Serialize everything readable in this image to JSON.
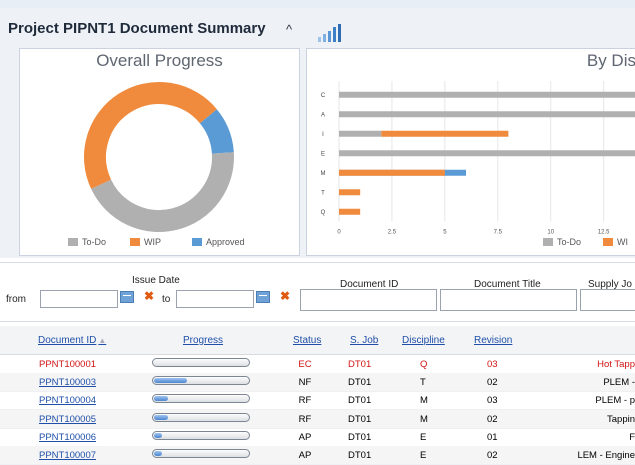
{
  "header": {
    "title": "Project PIPNT1 Document Summary",
    "caret": "^"
  },
  "overall_panel": {
    "title": "Overall Progress",
    "legend": [
      {
        "label": "To-Do",
        "color": "#b0b0b0"
      },
      {
        "label": "WIP",
        "color": "#f08a3c"
      },
      {
        "label": "Approved",
        "color": "#5b9bd5"
      }
    ]
  },
  "discipline_panel": {
    "title": "By Dis",
    "legend": [
      {
        "label": "To-Do",
        "color": "#b0b0b0"
      },
      {
        "label": "WI",
        "color": "#f08a3c"
      }
    ]
  },
  "chart_data": [
    {
      "type": "pie",
      "title": "Overall Progress",
      "labels": [
        "To-Do",
        "WIP",
        "Approved"
      ],
      "values": [
        44,
        46,
        10
      ],
      "colors": [
        "#b0b0b0",
        "#f08a3c",
        "#5b9bd5"
      ]
    },
    {
      "type": "bar",
      "title": "By Dis",
      "orientation": "horizontal",
      "categories": [
        "C",
        "A",
        "I",
        "E",
        "M",
        "T",
        "Q"
      ],
      "xticks": [
        "0",
        "2.5",
        "5",
        "7.5",
        "10",
        "12.5"
      ],
      "xlim": [
        0,
        14.5
      ],
      "series": [
        {
          "name": "To-Do",
          "color": "#b0b0b0",
          "start": [
            0,
            0,
            0,
            0,
            0,
            0,
            0
          ],
          "values": [
            14.5,
            14.5,
            2.0,
            14.0,
            5.0,
            0,
            0
          ]
        },
        {
          "name": "WIP",
          "color": "#f08a3c",
          "start": [
            0,
            0,
            2.0,
            14.0,
            0,
            0,
            0
          ],
          "values": [
            0,
            0,
            6.0,
            0.5,
            5.0,
            1.0,
            1.0
          ]
        },
        {
          "name": "Approved",
          "color": "#5b9bd5",
          "start": [
            0,
            0,
            0,
            0,
            5.0,
            0,
            0
          ],
          "values": [
            0,
            0,
            0,
            0,
            1.0,
            0,
            0
          ]
        }
      ]
    }
  ],
  "filters": {
    "issue_date_label": "Issue Date",
    "from_label": "from",
    "to_label": "to",
    "document_id_label": "Document ID",
    "document_title_label": "Document Title",
    "supply_job_label": "Supply Jo",
    "clear_glyph": "✖",
    "sort_glyph": "▲"
  },
  "grid": {
    "headers": {
      "doc_id": "Document ID",
      "progress": "Progress",
      "status": "Status",
      "sjob": "S. Job",
      "discipline": "Discipline",
      "revision": "Revision"
    },
    "rows": [
      {
        "doc_id": "PPNT100001",
        "progress": 0.0,
        "status": "EC",
        "sjob": "DT01",
        "discipline": "Q",
        "revision": "03",
        "title": "Hot Tapp",
        "highlight": true
      },
      {
        "doc_id": "PPNT100003",
        "progress": 0.35,
        "status": "NF",
        "sjob": "DT01",
        "discipline": "T",
        "revision": "02",
        "title": "PLEM -",
        "highlight": false
      },
      {
        "doc_id": "PPNT100004",
        "progress": 0.15,
        "status": "RF",
        "sjob": "DT01",
        "discipline": "M",
        "revision": "03",
        "title": "PLEM - p",
        "highlight": false
      },
      {
        "doc_id": "PPNT100005",
        "progress": 0.15,
        "status": "RF",
        "sjob": "DT01",
        "discipline": "M",
        "revision": "02",
        "title": "Tappin",
        "highlight": false
      },
      {
        "doc_id": "PPNT100006",
        "progress": 0.08,
        "status": "AP",
        "sjob": "DT01",
        "discipline": "E",
        "revision": "01",
        "title": "F",
        "highlight": false
      },
      {
        "doc_id": "PPNT100007",
        "progress": 0.08,
        "status": "AP",
        "sjob": "DT01",
        "discipline": "E",
        "revision": "02",
        "title": "LEM - Engine",
        "highlight": false
      }
    ]
  }
}
